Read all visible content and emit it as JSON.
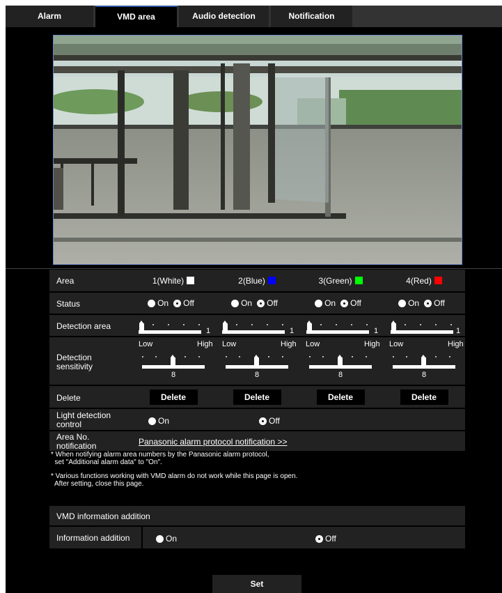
{
  "tabs": [
    {
      "label": "Alarm",
      "active": false
    },
    {
      "label": "VMD area",
      "active": true
    },
    {
      "label": "Audio detection",
      "active": false
    },
    {
      "label": "Notification",
      "active": false
    }
  ],
  "table": {
    "area_label": "Area",
    "areas": [
      {
        "label": "1(White)",
        "color": "#ffffff"
      },
      {
        "label": "2(Blue)",
        "color": "#0000ff"
      },
      {
        "label": "3(Green)",
        "color": "#00ff00"
      },
      {
        "label": "4(Red)",
        "color": "#ff0000"
      }
    ],
    "status_label": "Status",
    "status_on": "On",
    "status_off": "Off",
    "status_selected": "Off",
    "detection_area_label": "Detection area",
    "detection_area_values": [
      "1",
      "1",
      "1",
      "1"
    ],
    "sensitivity_label": "Detection sensitivity",
    "sensitivity_low": "Low",
    "sensitivity_high": "High",
    "sensitivity_values": [
      "8",
      "8",
      "8",
      "8"
    ],
    "delete_label": "Delete",
    "delete_button": "Delete",
    "light_label": "Light detection control",
    "light_on": "On",
    "light_off": "Off",
    "light_selected": "Off",
    "area_no_label": "Area No. notification",
    "area_no_link": "Panasonic alarm protocol notification >>"
  },
  "notes": [
    "* When notifying alarm area numbers by the Panasonic alarm protocol,\n  set \"Additional alarm data\" to \"On\".",
    "* Various functions working with VMD alarm do not work while this page is open.\n  After setting, close this page."
  ],
  "info": {
    "header": "VMD information addition",
    "label": "Information addition",
    "on": "On",
    "off": "Off",
    "selected": "Off"
  },
  "set_button": "Set"
}
